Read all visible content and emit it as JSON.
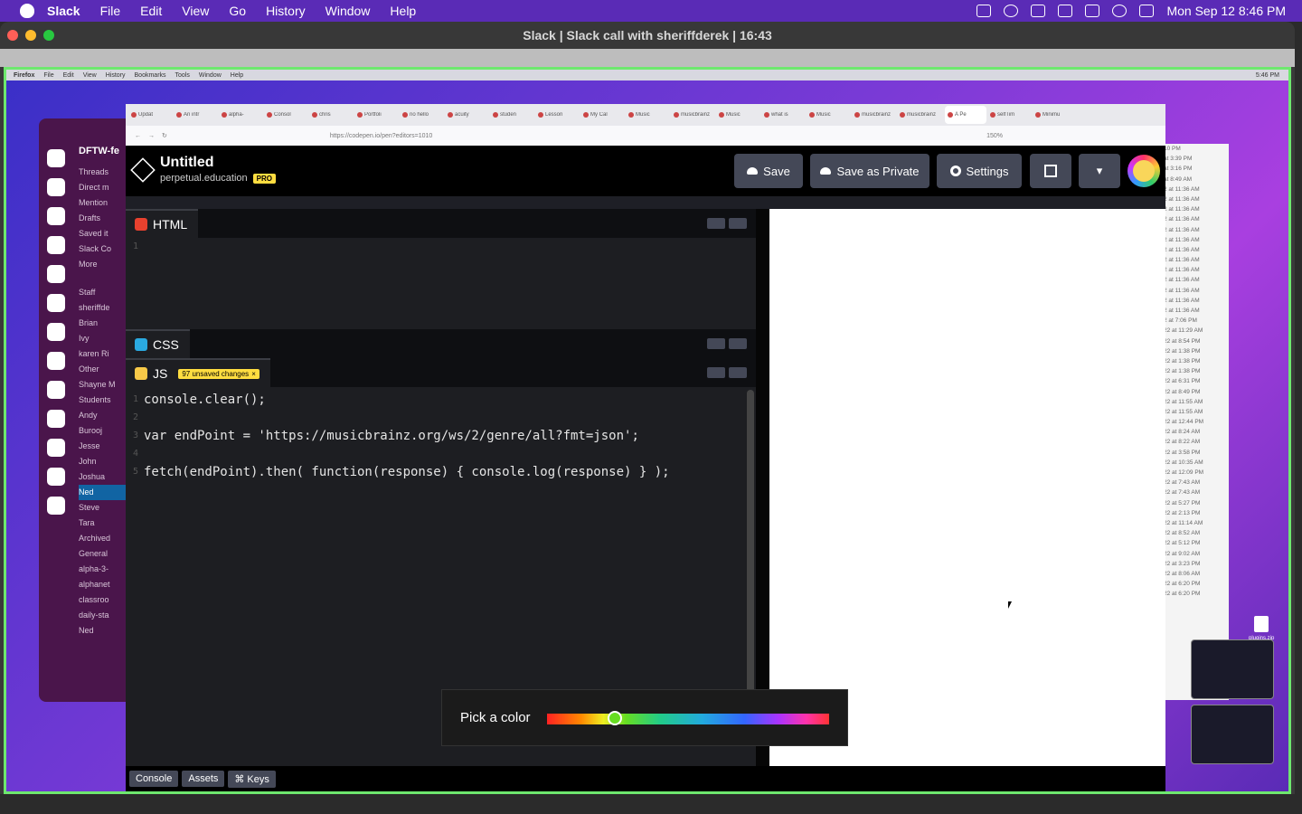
{
  "menubar": {
    "items": [
      "Slack",
      "File",
      "Edit",
      "View",
      "Go",
      "History",
      "Window",
      "Help"
    ],
    "clock": "Mon Sep 12  8:46 PM"
  },
  "window": {
    "title": "Slack | Slack call with sheriffderek | 16:43"
  },
  "shared_screen": {
    "ff_menu": [
      "Firefox",
      "File",
      "Edit",
      "View",
      "History",
      "Bookmarks",
      "Tools",
      "Window",
      "Help"
    ],
    "ff_clock": "5:46 PM",
    "slack": {
      "workspace": "DFTW-fe",
      "items": [
        "Threads",
        "Direct m",
        "Mention",
        "Drafts",
        "Saved it",
        "Slack Co",
        "More"
      ],
      "people": [
        "Staff",
        "sheriffde",
        "Brian",
        "Ivy",
        "karen Ri",
        "Other",
        "Shayne M",
        "Students",
        "Andy",
        "Burooj",
        "Jesse",
        "John",
        "Joshua",
        "Ned",
        "Steve",
        "Tara",
        "Archived",
        "General",
        "alpha-3-",
        "alphanet",
        "classroo",
        "daily-sta",
        "Ned"
      ]
    },
    "right_panel": [
      "10 PM",
      "at 3:39 PM",
      "at 3:16 PM",
      "at 8:49 AM",
      "2 at 11:36 AM",
      "2 at 11:36 AM",
      "2 at 11:36 AM",
      "2 at 11:36 AM",
      "2 at 11:36 AM",
      "2 at 11:36 AM",
      "2 at 11:36 AM",
      "2 at 11:36 AM",
      "2 at 11:36 AM",
      "2 at 11:36 AM",
      "2 at 11:36 AM",
      "2 at 11:36 AM",
      "2 at 11:36 AM",
      "2 at 7:06 PM",
      "22 at 11:29 AM",
      "22 at 8:54 PM",
      "22 at 1:38 PM",
      "22 at 1:38 PM",
      "22 at 1:38 PM",
      "22 at 6:31 PM",
      "22 at 8:49 PM",
      "22 at 11:55 AM",
      "22 at 11:55 AM",
      "22 at 12:44 PM",
      "22 at 8:24 AM",
      "22 at 8:22 AM",
      "22 at 3:58 PM",
      "22 at 10:35 AM",
      "22 at 12:09 PM",
      "22 at 7:43 AM",
      "22 at 7:43 AM",
      "22 at 5:27 PM",
      "22 at 2:13 PM",
      "22 at 11:14 AM",
      "22 at 8:52 AM",
      "22 at 5:12 PM",
      "22 at 9:02 AM",
      "22 at 3:23 PM",
      "22 at 8:06 AM",
      "22 at 6:20 PM",
      "22 at 6:20 PM"
    ],
    "tabs": [
      "Updat",
      "An intr",
      "alpha-",
      "Consol",
      "chris",
      "Portfoli",
      "no hello",
      "acuity",
      "studen",
      "Lesson",
      "My Cal",
      "Music",
      "musicbrainz",
      "Music",
      "what is",
      "Music",
      "musicbrainz",
      "musicbrainz",
      "A Pe",
      "selfTim",
      "Minimu"
    ],
    "url": "https://codepen.io/pen?editors=1010",
    "zoom": "150%",
    "codepen": {
      "title": "Untitled",
      "owner": "perpetual.education",
      "badge": "PRO",
      "buttons": {
        "save": "Save",
        "save_private": "Save as Private",
        "settings": "Settings"
      },
      "html_tab": "HTML",
      "css_tab": "CSS",
      "js_tab": "JS",
      "unsaved": "97 unsaved changes",
      "html_line": "1",
      "js_lines": [
        {
          "n": "1",
          "code": "console.clear();"
        },
        {
          "n": "2",
          "code": ""
        },
        {
          "n": "3",
          "code": "var endPoint = 'https://musicbrainz.org/ws/2/genre/all?fmt=json';"
        },
        {
          "n": "4",
          "code": ""
        },
        {
          "n": "5",
          "code": "fetch(endPoint).then( function(response) { console.log(response) } );"
        }
      ],
      "bottom": [
        "Console",
        "Assets",
        "⌘ Keys"
      ]
    },
    "zip_label": "plugins.zip"
  },
  "color_picker": {
    "label": "Pick a color",
    "value": 0.24
  },
  "colors": {
    "accent": "#6ee86e",
    "slack": "#4a154b"
  }
}
